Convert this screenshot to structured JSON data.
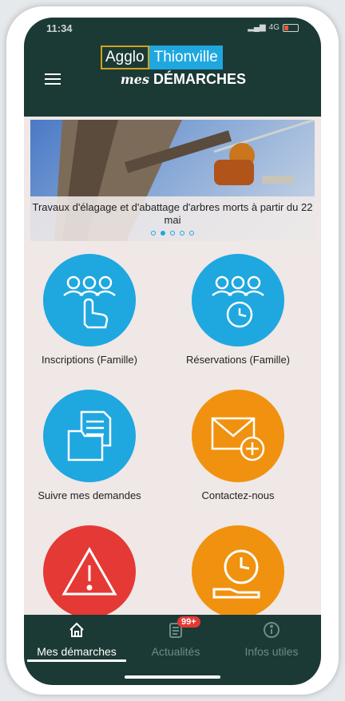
{
  "status": {
    "time": "11:34",
    "network": "4G"
  },
  "header": {
    "logo_left": "Agglo",
    "logo_right": "Thionville",
    "logo_sub_italic": "mes",
    "logo_sub": "DÉMARCHES"
  },
  "banner": {
    "caption": "Travaux d'élagage et d'abattage d'arbres morts à partir du 22 mai",
    "slides": 5,
    "active_slide": 2
  },
  "tiles": [
    {
      "label": "Inscriptions (Famille)",
      "color": "#1fa7e0",
      "icon": "people-hand-icon"
    },
    {
      "label": "Réservations (Famille)",
      "color": "#1fa7e0",
      "icon": "people-clock-icon"
    },
    {
      "label": "Suivre mes demandes",
      "color": "#1fa7e0",
      "icon": "documents-folder-icon"
    },
    {
      "label": "Contactez-nous",
      "color": "#f0920f",
      "icon": "mail-add-icon"
    },
    {
      "label": "",
      "color": "#e53935",
      "icon": "warning-icon"
    },
    {
      "label": "",
      "color": "#f0920f",
      "icon": "clock-hand-icon"
    }
  ],
  "tabbar": {
    "tabs": [
      {
        "label": "Mes démarches",
        "icon": "home-icon",
        "active": true
      },
      {
        "label": "Actualités",
        "icon": "news-icon",
        "badge": "99+"
      },
      {
        "label": "Infos utiles",
        "icon": "info-icon"
      }
    ]
  },
  "colors": {
    "header_bg": "#1c3a35",
    "blue": "#1fa7e0",
    "orange": "#f0920f",
    "red": "#e53935",
    "page_bg": "#efe8e6"
  }
}
